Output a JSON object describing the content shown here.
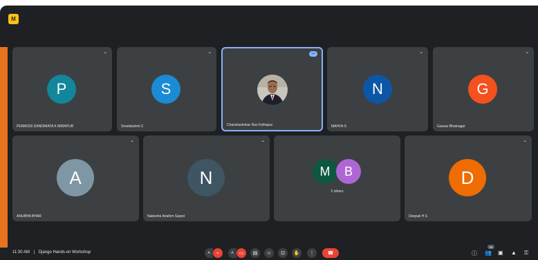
{
  "app": {
    "badge": "M"
  },
  "tiles": [
    {
      "initial": "P",
      "name": "PERMODI DANDIMATA K MIRAPUR",
      "color": "#12879b"
    },
    {
      "initial": "S",
      "name": "Sreelakshmi C",
      "color": "#1a8bd4"
    },
    {
      "initial": "",
      "name": "Chandrashekar Rao Kolhapur",
      "color": "#3c4043"
    },
    {
      "initial": "N",
      "name": "MAHYA S",
      "color": "#0b57a6"
    },
    {
      "initial": "G",
      "name": "Gaurav Bhatnagar",
      "color": "#f4511e"
    },
    {
      "initial": "A",
      "name": "ANUBHA BHAR",
      "color": "#7f97a5"
    },
    {
      "initial": "N",
      "name": "Nabeeha Ibrahim Sayed",
      "color": "#3f5562"
    },
    {
      "initial_1": "M",
      "initial_2": "B",
      "name": "2 others",
      "color_1": "#0e5740",
      "color_2": "#ae67d2"
    },
    {
      "initial": "D",
      "name": "Deepak H S",
      "color": "#ef6c00"
    }
  ],
  "bottom_bar": {
    "time": "11:30 AM",
    "separator": "|",
    "meeting_title": "Django Hands-on Workshop",
    "participant_count": "26"
  },
  "icons": {
    "mic_off": "mic-off-icon",
    "camera_off": "camera-off-icon",
    "captions": "captions-icon",
    "emoji": "emoji-icon",
    "present": "present-icon",
    "hand": "raise-hand-icon",
    "more": "more-options-icon",
    "hangup": "hang-up-icon",
    "info": "info-icon",
    "people": "people-icon",
    "chat": "chat-icon",
    "activities": "activities-icon",
    "lock": "host-controls-icon"
  },
  "colors": {
    "background": "#1f2023",
    "tile": "#3c4043",
    "active_border": "#8ab4f8",
    "hangup": "#ea4335"
  }
}
